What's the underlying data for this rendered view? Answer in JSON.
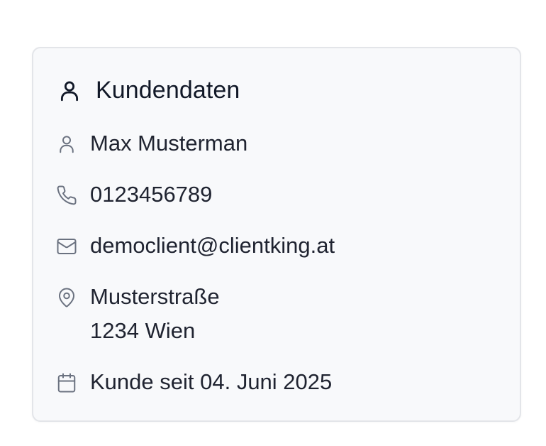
{
  "card": {
    "title": "Kundendaten",
    "title_icon": "user-icon"
  },
  "customer": {
    "name": "Max Musterman",
    "phone": "0123456789",
    "email": "democlient@clientking.at",
    "address_line1": "Musterstraße",
    "address_line2": "1234 Wien",
    "since": "Kunde seit 04. Juni 2025"
  },
  "icons": {
    "name": "user-icon",
    "phone": "phone-icon",
    "email": "mail-icon",
    "address": "map-pin-icon",
    "since": "calendar-icon"
  },
  "colors": {
    "card_background": "#f8f9fb",
    "card_border": "#e3e5e9",
    "icon_muted": "#6b7280",
    "text": "#1f2330"
  }
}
